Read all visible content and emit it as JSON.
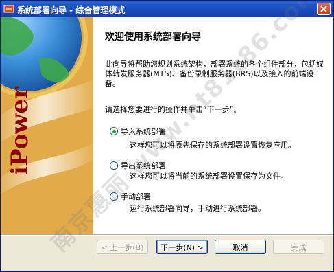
{
  "window": {
    "title": "系统部署向导 - 综合管理模式",
    "close_icon": "close-icon"
  },
  "banner": {
    "brand_text": "iPower",
    "globe_icon": "globe-icon"
  },
  "page": {
    "title": "欢迎使用系统部署向导",
    "intro": "此向导将帮助您规划系统架构，部署系统的各个组件部分，包括媒体转发服务器(MTS)、备份录制服务器(BRS)以及接入的前端设备。",
    "prompt": "请选择您要进行的操作并单击“下一步”。"
  },
  "options": [
    {
      "label": "导入系统部署",
      "description": "这样您可以将原先保存的系统部署设置恢复应用。",
      "selected": true
    },
    {
      "label": "导出系统部署",
      "description": "这样您可以将当前的系统部署设置保存为文件。",
      "selected": false
    },
    {
      "label": "手动部署",
      "description": "运行系统部署向导，手动进行系统部署。",
      "selected": false
    }
  ],
  "buttons": {
    "back": "< 上一步(B)",
    "next": "下一步(N) >",
    "cancel": "取消",
    "finish": "完成"
  },
  "watermark": "南京惠丽 www.nt81t86.com",
  "colors": {
    "titlebar": "#1d4fc4",
    "banner": "#e6b24a",
    "brand_text": "#8b0000",
    "radio_dot": "#21a121"
  }
}
